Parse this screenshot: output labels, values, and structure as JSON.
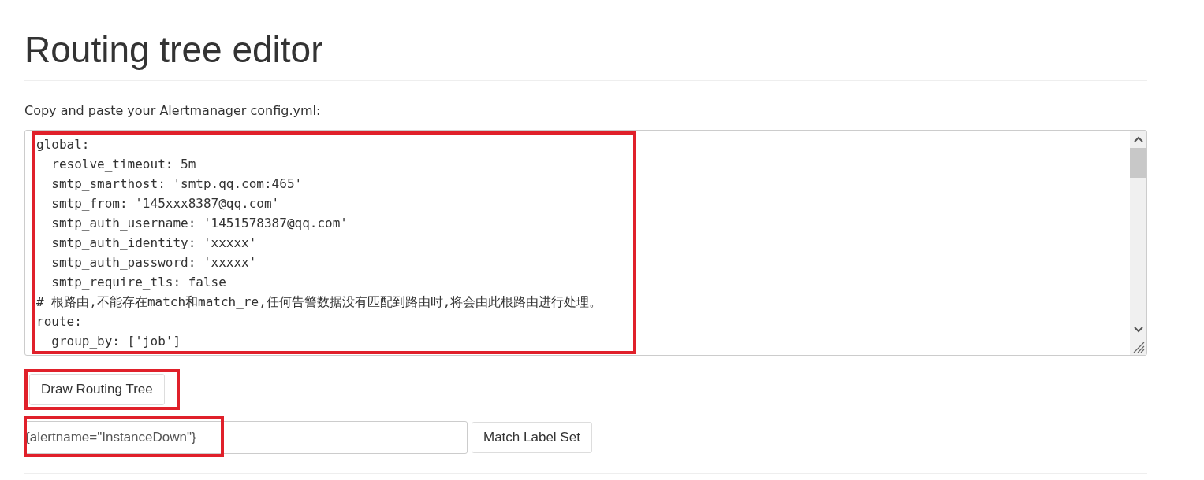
{
  "title": "Routing tree editor",
  "config_label": "Copy and paste your Alertmanager config.yml:",
  "config_editor": {
    "highlighted": true,
    "lines": [
      "global:",
      "  resolve_timeout: 5m",
      "  smtp_smarthost: 'smtp.qq.com:465'",
      "  smtp_from: '145xxx8387@qq.com'",
      "  smtp_auth_username: '1451578387@qq.com'",
      "  smtp_auth_identity: 'xxxxx'",
      "  smtp_auth_password: 'xxxxx'",
      "  smtp_require_tls: false",
      "# 根路由,不能存在match和match_re,任何告警数据没有匹配到路由时,将会由此根路由进行处理。",
      "route:",
      "  group_by: ['job']"
    ]
  },
  "draw_button": {
    "label": "Draw Routing Tree",
    "highlighted": true
  },
  "label_set": {
    "value": "{alertname=\"InstanceDown\"}",
    "highlighted": true,
    "button": "Match Label Set"
  }
}
